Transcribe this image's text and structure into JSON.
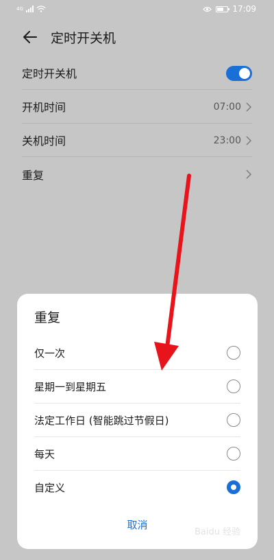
{
  "status_bar": {
    "network": "4G",
    "time": "17:09",
    "icons": [
      "signal-icon",
      "wifi-icon",
      "eye-icon",
      "battery-icon"
    ]
  },
  "header": {
    "title": "定时开关机",
    "back_icon": "arrow-left-icon"
  },
  "settings": {
    "items": [
      {
        "label": "定时开关机",
        "value": "",
        "control": "toggle",
        "on": true
      },
      {
        "label": "开机时间",
        "value": "07:00",
        "control": "chevron"
      },
      {
        "label": "关机时间",
        "value": "23:00",
        "control": "chevron"
      },
      {
        "label": "重复",
        "value": "",
        "control": "chevron"
      }
    ]
  },
  "dialog": {
    "title": "重复",
    "options": [
      {
        "label": "仅一次",
        "selected": false
      },
      {
        "label": "星期一到星期五",
        "selected": false
      },
      {
        "label": "法定工作日 (智能跳过节假日)",
        "selected": false
      },
      {
        "label": "每天",
        "selected": false
      },
      {
        "label": "自定义",
        "selected": true
      }
    ],
    "cancel_label": "取消"
  },
  "colors": {
    "accent": "#1a6fd6",
    "backdrop": "#c6c6c6",
    "annotation_arrow": "#e8141c"
  },
  "watermark": "Baidu 经验"
}
